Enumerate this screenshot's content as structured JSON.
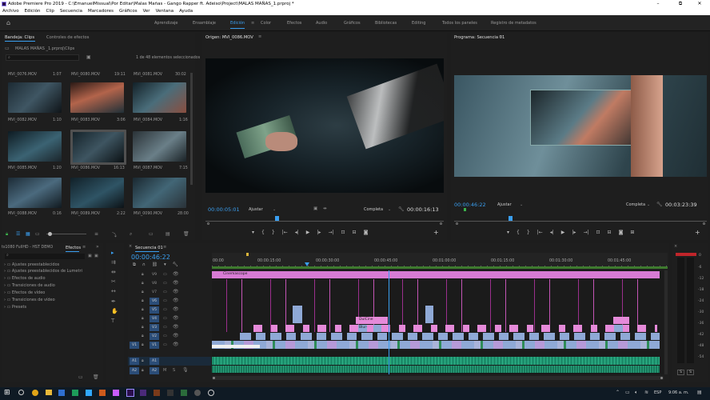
{
  "window": {
    "title": "Adobe Premiere Pro 2019 - C:\\EmanuelMissual\\Por Editar\\Malas Mañas - Gango Rapper ft. Adeiso\\Project\\MALAS MAÑAS_1.prproj *",
    "min": "–",
    "max": "⧉",
    "close": "✕"
  },
  "menu": [
    "Archivo",
    "Edición",
    "Clip",
    "Secuencia",
    "Marcadores",
    "Gráficos",
    "Ver",
    "Ventana",
    "Ayuda"
  ],
  "workspaces": [
    "Aprendizaje",
    "Ensamblaje",
    "Edición",
    "Color",
    "Efectos",
    "Audio",
    "Gráficos",
    "Bibliotecas",
    "Editing",
    "Todos los paneles",
    "Registro de metadatos"
  ],
  "active_workspace": "Edición",
  "project": {
    "tabs": [
      "Bandeja: Clips",
      "Controles de efectos"
    ],
    "path": "MALAS MAÑAS _1.prproj\\Clips",
    "search_placeholder": "",
    "count": "1 de 48 elementos seleccionados",
    "top_row": [
      {
        "name": "MVI_0076.MOV",
        "dur": "1:07"
      },
      {
        "name": "MVI_0080.MOV",
        "dur": "19:11"
      },
      {
        "name": "MVI_0081.MOV",
        "dur": "30:02"
      }
    ],
    "clips": [
      {
        "name": "MVI_0082.MOV",
        "dur": "1:10"
      },
      {
        "name": "MVI_0083.MOV",
        "dur": "3:06"
      },
      {
        "name": "MVI_0084.MOV",
        "dur": "1:16"
      },
      {
        "name": "MVI_0085.MOV",
        "dur": "1:20"
      },
      {
        "name": "MVI_0086.MOV",
        "dur": "16:13"
      },
      {
        "name": "MVI_0087.MOV",
        "dur": "7:15"
      },
      {
        "name": "MVI_0088.MOV",
        "dur": "0:16"
      },
      {
        "name": "MVI_0089.MOV",
        "dur": "2:22"
      },
      {
        "name": "MVI_0090.MOV",
        "dur": "28:00"
      }
    ]
  },
  "source": {
    "title": "Origen: MVI_0086.MOV",
    "tc_left": "00:00:05:01",
    "fit": "Ajustar",
    "quality": "Completa",
    "tc_right": "00:00:16:13"
  },
  "program": {
    "title": "Programa: Secuencia 01",
    "tc_left": "00:00:46:22",
    "fit": "Ajustar",
    "quality": "Completa",
    "tc_right": "00:03:23:39"
  },
  "effects": {
    "tabs": [
      "ts1080 FullHD - HST DEMO",
      "Efectos"
    ],
    "items": [
      "Ajustes preestablecidos",
      "Ajustes preestablecidos de Lumetri",
      "Efectos de audio",
      "Transiciones de audio",
      "Efectos de vídeo",
      "Transiciones de vídeo",
      "Presets"
    ]
  },
  "timeline": {
    "tab": "Secuencia 01",
    "timecode": "00:00:46:22",
    "ruler": [
      "00:00",
      "00:00:15:00",
      "00:00:30:00",
      "00:00:45:00",
      "00:01:00:00",
      "00:01:15:00",
      "00:01:30:00",
      "00:01:45:00"
    ],
    "video_tracks": [
      "V9",
      "V8",
      "V7",
      "V6",
      "V5",
      "V4",
      "V3",
      "V2",
      "V1"
    ],
    "audio_tracks": [
      "A1",
      "A2"
    ],
    "adjustment_label": "Cinemascope",
    "title_labels": [
      "DulCine",
      "Blur-V"
    ],
    "v1_label": "V1"
  },
  "meter": {
    "labels": [
      "0",
      "-6",
      "-12",
      "-18",
      "-24",
      "-30",
      "-36",
      "-42",
      "-48",
      "-54"
    ],
    "solo": "S",
    "solo2": "S"
  },
  "taskbar": {
    "lang": "ESP",
    "time": "9:06 a. m."
  },
  "colors": {
    "accent": "#3a9ff0",
    "video_clip": "#8fa9d6",
    "pink_clip": "#e58ad9",
    "adj": "#d77bd4",
    "audio": "#1c8c6a"
  }
}
